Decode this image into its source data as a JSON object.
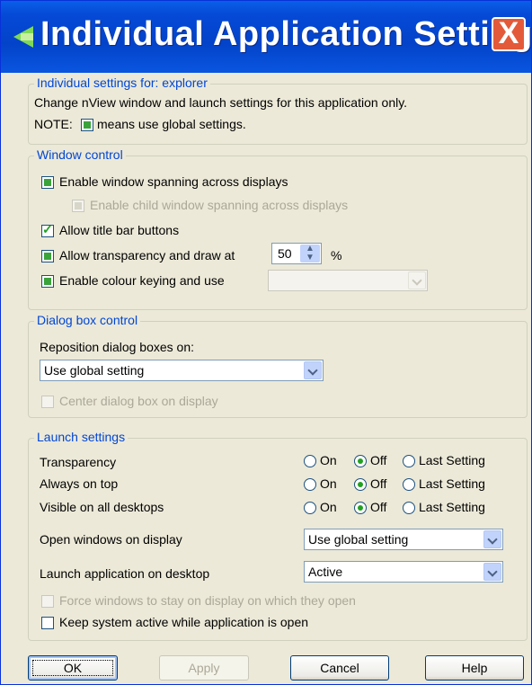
{
  "window": {
    "title": "Individual Application Settings",
    "close": "X"
  },
  "info": {
    "legend": "Individual settings for: explorer",
    "line1": "Change nView window and launch settings for this application only.",
    "note_prefix": "NOTE:",
    "note_suffix": "means use global settings."
  },
  "window_control": {
    "legend": "Window control",
    "spanning": "Enable window spanning across displays",
    "child_spanning": "Enable child window spanning across displays",
    "title_bar": "Allow title bar buttons",
    "transparency": "Allow transparency and draw at",
    "transparency_value": "50",
    "percent": "%",
    "colour_keying": "Enable colour keying and use",
    "colour_value": ""
  },
  "dialog_control": {
    "legend": "Dialog box control",
    "reposition_label": "Reposition dialog boxes on:",
    "reposition_value": "Use global setting",
    "center": "Center dialog box on display"
  },
  "launch": {
    "legend": "Launch settings",
    "rows": [
      {
        "label": "Transparency",
        "on": "On",
        "off": "Off",
        "last": "Last Setting"
      },
      {
        "label": "Always on top",
        "on": "On",
        "off": "Off",
        "last": "Last Setting"
      },
      {
        "label": "Visible on all desktops",
        "on": "On",
        "off": "Off",
        "last": "Last Setting"
      }
    ],
    "open_display_label": "Open windows on display",
    "open_display_value": "Use global setting",
    "launch_desktop_label": "Launch application on desktop",
    "launch_desktop_value": "Active",
    "force_stay": "Force windows to stay on display on which they open",
    "keep_active": "Keep system active while application is open"
  },
  "buttons": {
    "ok": "OK",
    "apply": "Apply",
    "cancel": "Cancel",
    "help": "Help"
  }
}
